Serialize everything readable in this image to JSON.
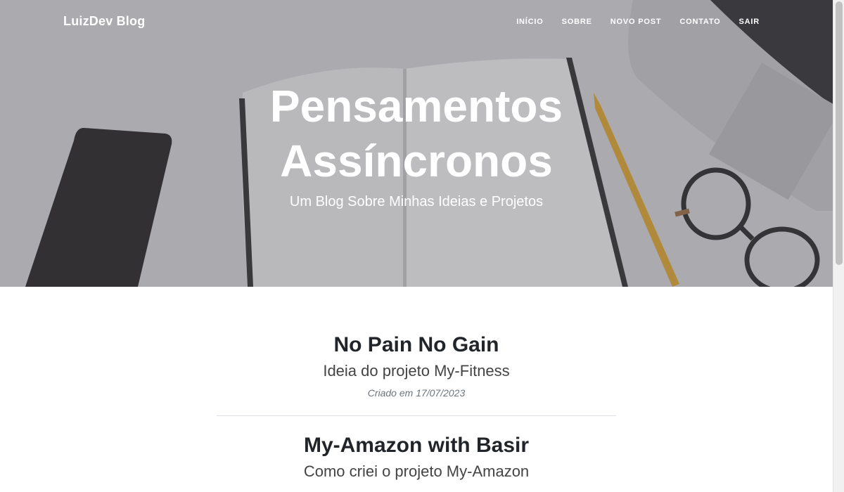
{
  "nav": {
    "brand": "LuizDev Blog",
    "links": [
      "INÍCIO",
      "SOBRE",
      "NOVO POST",
      "CONTATO",
      "SAIR"
    ]
  },
  "hero": {
    "title_line1": "Pensamentos",
    "title_line2": "Assíncronos",
    "subtitle": "Um Blog Sobre Minhas Ideias e Projetos"
  },
  "posts": [
    {
      "title": "No Pain No Gain",
      "subtitle": "Ideia do projeto My-Fitness",
      "meta": "Criado em 17/07/2023"
    },
    {
      "title": "My-Amazon with Basir",
      "subtitle": "Como criei o projeto My-Amazon"
    }
  ]
}
